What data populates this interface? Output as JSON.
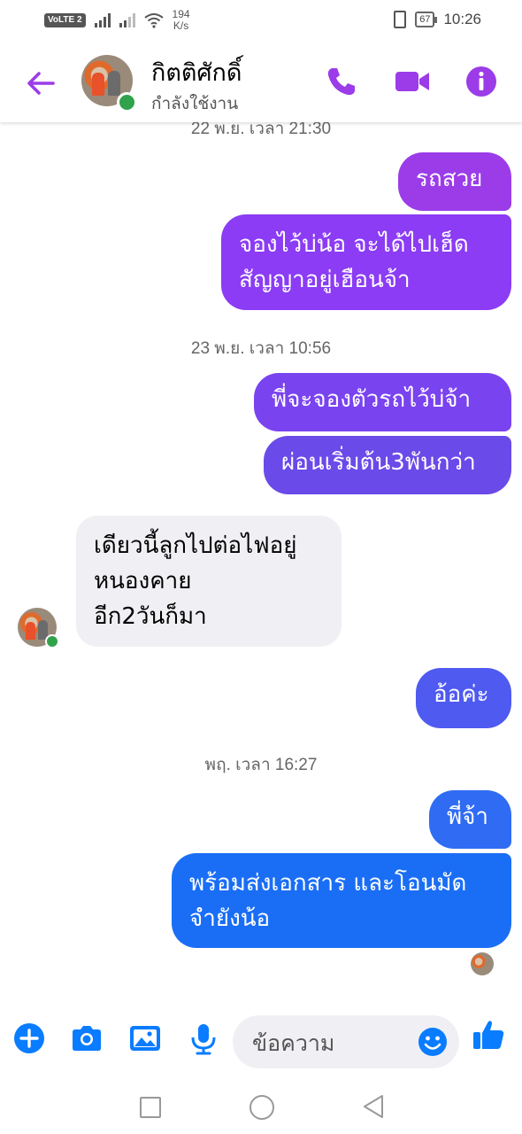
{
  "status_bar": {
    "volte": "VoLTE",
    "sim_slot": "2",
    "speed_value": "194",
    "speed_unit": "K/s",
    "battery": "67",
    "time": "10:26"
  },
  "header": {
    "contact_name": "กิตติศักดิ์",
    "contact_status": "กำลังใช้งาน",
    "accent_color": "#9b3ce8"
  },
  "chat": {
    "timestamps": {
      "t1": "22 พ.ย. เวลา 21:30",
      "t2": "23 พ.ย. เวลา 10:56",
      "t3": "พฤ. เวลา 16:27"
    },
    "messages": [
      {
        "from": "me",
        "text": "รถสวย"
      },
      {
        "from": "me",
        "lines": [
          "จองไว้บ่น้อ จะได้ไปเฮ็ด",
          "สัญญาอยู่เฮือนจ้า"
        ]
      },
      {
        "from": "me",
        "text": "พี่จะจองตัวรถไว้บ่จ้า"
      },
      {
        "from": "me",
        "text": "ผ่อนเริ่มต้น3พันกว่า"
      },
      {
        "from": "contact",
        "lines": [
          "เดียวนี้ลูกไปต่อไฟอยู่",
          "หนองคาย",
          "อีก2วันก็มา"
        ]
      },
      {
        "from": "me",
        "text": "อ้อค่ะ"
      },
      {
        "from": "me",
        "text": "พี่จ้า"
      },
      {
        "from": "me",
        "lines": [
          "พร้อมส่งเอกสาร และโอนมัด",
          "จำยังน้อ"
        ]
      }
    ]
  },
  "composer": {
    "placeholder": "ข้อความ",
    "icons": [
      "plus-icon",
      "camera-icon",
      "image-icon",
      "microphone-icon",
      "emoji-icon",
      "thumbs-up-icon"
    ],
    "icon_color": "#0a7cff"
  }
}
